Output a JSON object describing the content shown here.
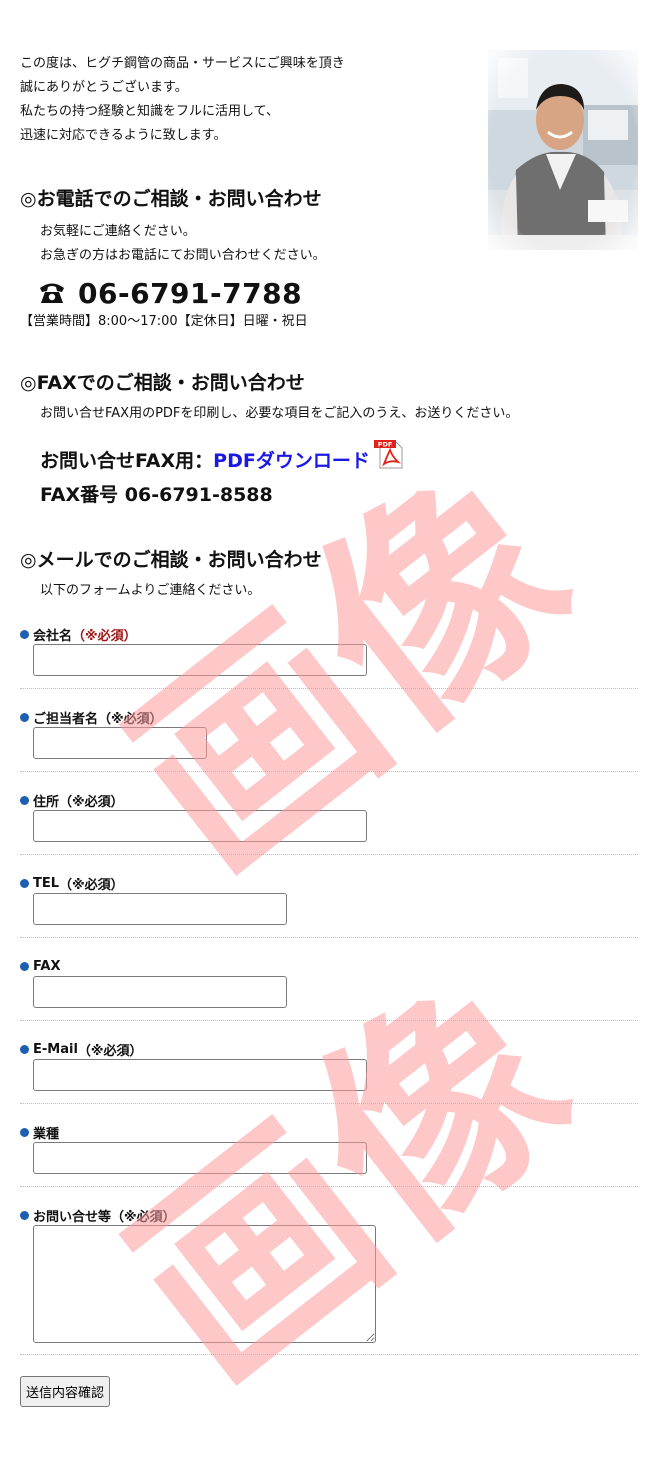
{
  "intro": {
    "lines": [
      "この度は、ヒグチ鋼管の商品・サービスにご興味を頂き",
      "誠にありがとうございます。",
      "私たちの持つ経験と知識をフルに活用して、",
      "迅速に対応できるように致します。"
    ]
  },
  "phone_section": {
    "title": "◎お電話でのご相談・お問い合わせ",
    "line1": "お気軽にご連絡ください。",
    "line2": "お急ぎの方はお電話にてお問い合わせください。",
    "number": "06-6791-7788",
    "hours": "【営業時間】8:00〜17:00【定休日】日曜・祝日"
  },
  "fax_section": {
    "title": "◎FAXでのご相談・お問い合わせ",
    "desc": "お問い合せFAX用のPDFを印刷し、必要な項目をご記入のうえ、お送りください。",
    "dl_label": "お問い合せFAX用：",
    "dl_link": "PDFダウンロード",
    "pdf_badge": "PDF",
    "fax_number": "FAX番号 06-6791-8588"
  },
  "mail_section": {
    "title": "◎メールでのご相談・お問い合わせ",
    "desc": "以下のフォームよりご連絡ください。"
  },
  "form": {
    "fields": [
      {
        "label": "会社名",
        "required": "（※必須）"
      },
      {
        "label": "ご担当者名",
        "required": "（※必須）"
      },
      {
        "label": "住所",
        "required": "（※必須）"
      },
      {
        "label": "TEL",
        "required": "（※必須）"
      },
      {
        "label": "FAX",
        "required": ""
      },
      {
        "label": "E-Mail",
        "required": "（※必須）"
      },
      {
        "label": "業種",
        "required": ""
      },
      {
        "label": "お問い合せ等",
        "required": "（※必須）"
      }
    ],
    "submit": "送信内容確認"
  },
  "watermark": {
    "text": "画像",
    "color": "#ff9a9a"
  },
  "colors": {
    "link": "#1a18e6",
    "bullet": "#1f5fb2",
    "required": "#a01818"
  }
}
